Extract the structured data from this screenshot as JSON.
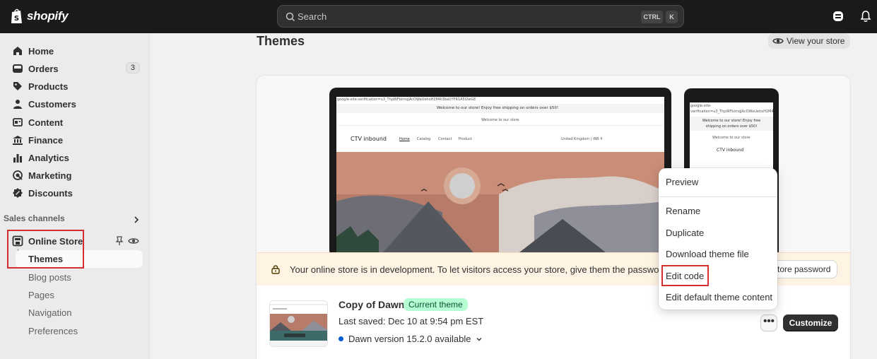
{
  "topbar": {
    "logo_text": "shopify",
    "search_placeholder": "Search",
    "shortcut_ctrl": "CTRL",
    "shortcut_k": "K"
  },
  "sidebar": {
    "items": [
      {
        "label": "Home",
        "icon": "home-icon"
      },
      {
        "label": "Orders",
        "icon": "orders-icon",
        "count": "3"
      },
      {
        "label": "Products",
        "icon": "tag-icon"
      },
      {
        "label": "Customers",
        "icon": "person-icon"
      },
      {
        "label": "Content",
        "icon": "content-icon"
      },
      {
        "label": "Finance",
        "icon": "bank-icon"
      },
      {
        "label": "Analytics",
        "icon": "bar-chart-icon"
      },
      {
        "label": "Marketing",
        "icon": "target-icon"
      },
      {
        "label": "Discounts",
        "icon": "discount-icon"
      }
    ],
    "sales_channels_title": "Sales channels",
    "online_store_label": "Online Store",
    "themes_label": "Themes",
    "sub_items": [
      "Blog posts",
      "Pages",
      "Navigation",
      "Preferences"
    ]
  },
  "main": {
    "title": "Themes",
    "view_store_label": "View your store",
    "dev_banner_text": "Your online store is in development. To let visitors access your store, give them the password.",
    "store_password_label": "tore password",
    "theme": {
      "name": "Copy of Dawn",
      "badge": "Current theme",
      "last_saved": "Last saved: Dec 10 at 9:54 pm EST",
      "version": "Dawn version 15.2.0 available"
    },
    "more_label": "•••",
    "customize_label": "Customize"
  },
  "preview": {
    "verification": "google-site-verification=u3_ThpWFbirnqjAcOWaUehoH2M4i3baUYFR1A5l2wGE",
    "announcement": "Welcome to our store! Enjoy free shipping on orders over $50!",
    "welcome": "Welcome to our store",
    "store_name": "CTV inbound",
    "nav": [
      "Home",
      "Catalog",
      "Contact",
      "Product"
    ],
    "region": "United Kingdom | INR ₹",
    "mobile_verification": "google-site-verification=u3_ThpWFbirnqjAcOWaUehoH2M4i3bau...",
    "mobile_announcement": "Welcome to our store! Enjoy free shipping on orders over $50!",
    "mobile_welcome": "Welcome to our store"
  },
  "menu": {
    "items": [
      "Preview",
      "Rename",
      "Duplicate",
      "Download theme file",
      "Edit code",
      "Edit default theme content"
    ]
  },
  "colors": {
    "topbar": "#1a1a1a",
    "highlight": "#d32f2f",
    "badge_bg": "#b4fed2",
    "accent_dot": "#005bd3"
  }
}
